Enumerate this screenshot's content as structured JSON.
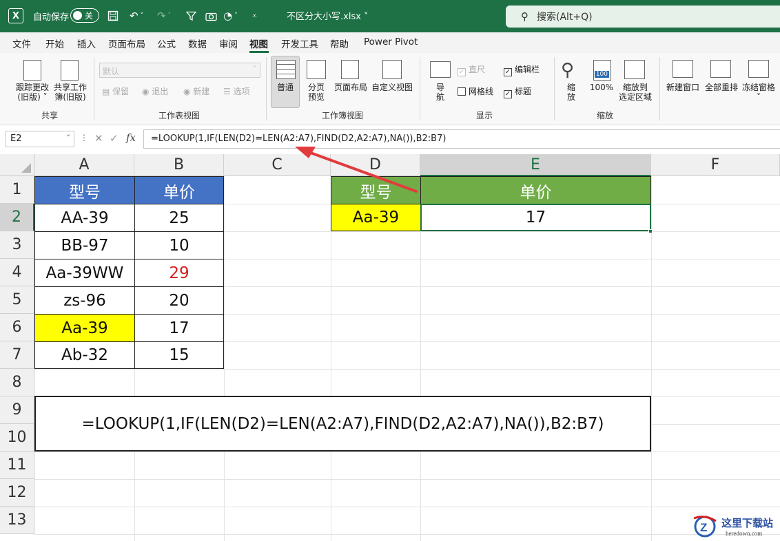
{
  "titlebar": {
    "autosave_label": "自动保存",
    "autosave_state": "关",
    "file_name": "不区分大小写.xlsx ˅",
    "search_placeholder": "搜索(Alt+Q)"
  },
  "menu": {
    "tabs": [
      "文件",
      "开始",
      "插入",
      "页面布局",
      "公式",
      "数据",
      "审阅",
      "视图",
      "开发工具",
      "帮助",
      "Power Pivot"
    ],
    "active": "视图"
  },
  "ribbon": {
    "share_group": {
      "label": "共享",
      "track_changes": "跟踪更改\n(旧版) ˅",
      "share_workbook": "共享工作\n簿(旧版)"
    },
    "sheet_view_group": {
      "label": "工作表视图",
      "dropdown_value": "默认",
      "keep": "保留",
      "exit": "退出",
      "new": "新建",
      "options": "选项"
    },
    "workbook_view_group": {
      "label": "工作簿视图",
      "normal": "普通",
      "page_break": "分页\n预览",
      "page_layout": "页面布局",
      "custom_views": "自定义视图"
    },
    "show_group": {
      "label": "显示",
      "navigation": "导\n航",
      "ruler": "直尺",
      "gridlines": "网格线",
      "formula_bar": "编辑栏",
      "headings": "标题"
    },
    "zoom_group": {
      "label": "缩放",
      "zoom": "缩\n放",
      "hundred": "100%",
      "zoom_selection": "缩放到\n选定区域",
      "hundred_icon": "100"
    },
    "window_group": {
      "new_window": "新建窗口",
      "arrange_all": "全部重排",
      "freeze_panes": "冻结窗格\n˅"
    }
  },
  "formula_bar": {
    "name_box": "E2",
    "formula": "=LOOKUP(1,IF(LEN(D2)=LEN(A2:A7),FIND(D2,A2:A7),NA()),B2:B7)"
  },
  "sheet": {
    "columns": [
      "A",
      "B",
      "C",
      "D",
      "E",
      "F"
    ],
    "rows": [
      "1",
      "2",
      "3",
      "4",
      "5",
      "6",
      "7",
      "8",
      "9",
      "10",
      "11",
      "12",
      "13"
    ],
    "table1": {
      "header_model": "型号",
      "header_price": "单价",
      "rows": [
        {
          "model": "AA-39",
          "price": "25"
        },
        {
          "model": "BB-97",
          "price": "10"
        },
        {
          "model": "Aa-39WW",
          "price": "29"
        },
        {
          "model": "zs-96",
          "price": "20"
        },
        {
          "model": "Aa-39",
          "price": "17"
        },
        {
          "model": "Ab-32",
          "price": "15"
        }
      ]
    },
    "table2": {
      "header_model": "型号",
      "header_price": "单价",
      "lookup_model": "Aa-39",
      "result_price": "17"
    },
    "formula_display": "=LOOKUP(1,IF(LEN(D2)=LEN(A2:A7),FIND(D2,A2:A7),NA()),B2:B7)"
  },
  "watermark": {
    "text": "这里下载站",
    "url": "heredown.com"
  },
  "colors": {
    "excel_green": "#1e7145",
    "header_blue": "#4472c4",
    "header_green": "#70ad47",
    "highlight_yellow": "#ffff00",
    "red_value": "#d42020",
    "arrow_red": "#e23b3b"
  }
}
